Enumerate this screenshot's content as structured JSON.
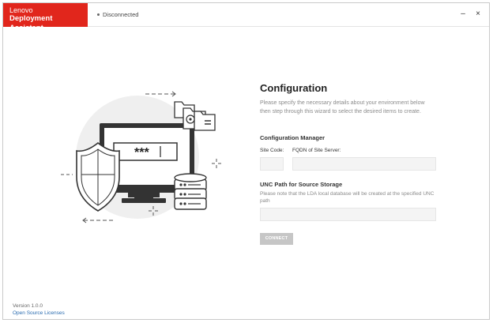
{
  "titlebar": {
    "brand_top": "Lenovo",
    "brand_bottom": "Deployment Assistant",
    "status": "Disconnected",
    "minimize": "–",
    "close": "×"
  },
  "illustration": {
    "password_text": "***",
    "icons": [
      "monitor-icon",
      "shield-icon",
      "database-icon",
      "folder-icon"
    ]
  },
  "main": {
    "title": "Configuration",
    "description": "Please specify the necessary details about your environment below then step through this wizard to select the desired items to create.",
    "config_manager": {
      "heading": "Configuration Manager",
      "site_code_label": "Site Code:",
      "fqdn_label": "FQDN of Site Server:",
      "site_code_value": "",
      "fqdn_value": ""
    },
    "unc": {
      "heading": "UNC Path for Source Storage",
      "note": "Please note that the LDA local database will be created at the specified UNC path",
      "value": ""
    },
    "connect_label": "CONNECT"
  },
  "footer": {
    "version": "Version 1.0.0",
    "license_link": "Open Source Licenses"
  },
  "colors": {
    "brand": "#e1261c",
    "disabled_button": "#c6c6c6",
    "link": "#2b6cb0",
    "input_bg": "#f4f4f4"
  }
}
